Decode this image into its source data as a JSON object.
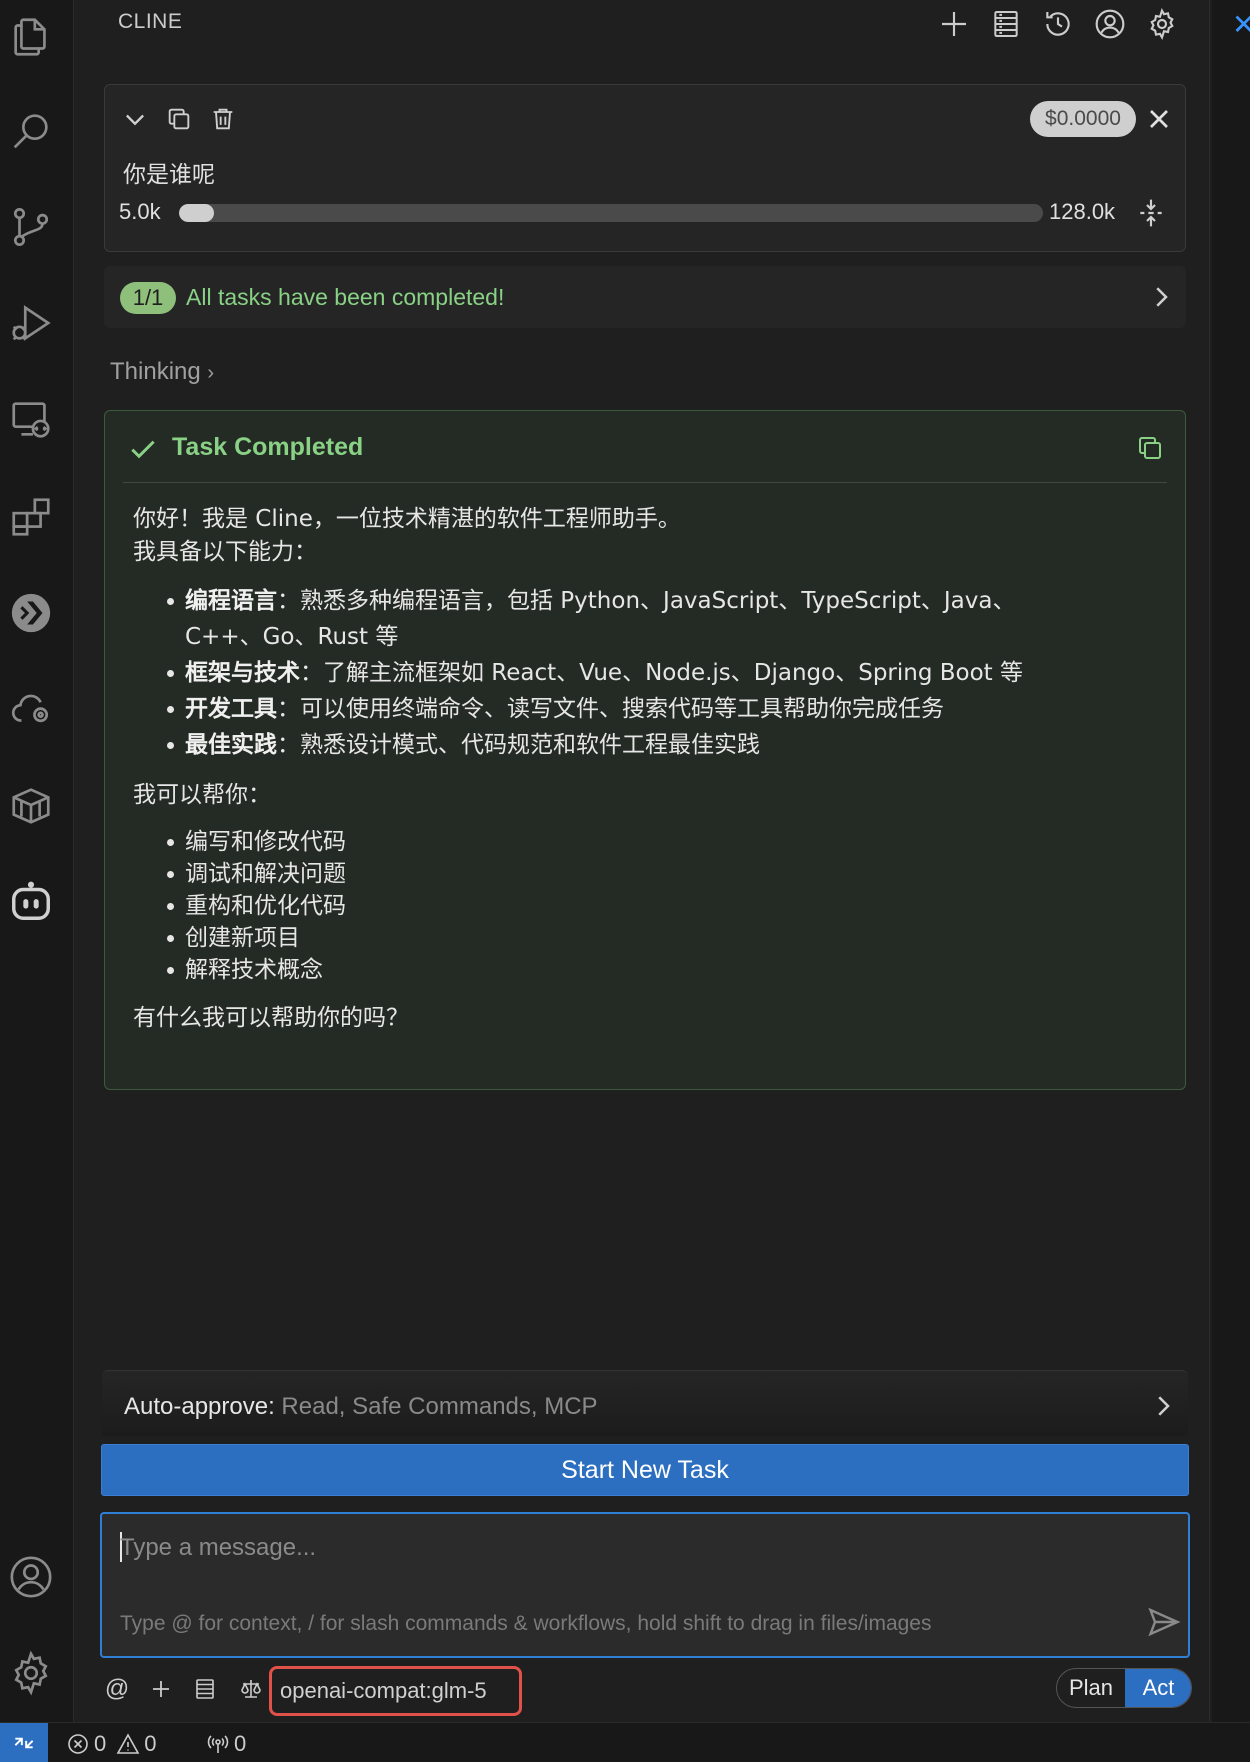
{
  "panel": {
    "title": "CLINE"
  },
  "task": {
    "text": "你是谁呢",
    "cost": "$0.0000",
    "tokens_used": "5.0k",
    "context_window": "128.0k",
    "context_used_fraction": 0.04
  },
  "tasks_progress": {
    "count": "1/1",
    "text": "All tasks have been completed!"
  },
  "thinking": {
    "label": "Thinking"
  },
  "completion": {
    "title": "Task Completed",
    "intro_line1": "你好！我是 Cline，一位技术精湛的软件工程师助手。",
    "intro_line2": "我具备以下能力：",
    "capabilities": [
      {
        "title": "编程语言",
        "text": "：熟悉多种编程语言，包括 Python、JavaScript、TypeScript、Java、",
        "text2": "C++、Go、Rust 等"
      },
      {
        "title": "框架与技术",
        "text": "：了解主流框架如 React、Vue、Node.js、Django、Spring Boot 等"
      },
      {
        "title": "开发工具",
        "text": "：可以使用终端命令、读写文件、搜索代码等工具帮助你完成任务"
      },
      {
        "title": "最佳实践",
        "text": "：熟悉设计模式、代码规范和软件工程最佳实践"
      }
    ],
    "help_heading": "我可以帮你：",
    "help_items": [
      "编写和修改代码",
      "调试和解决问题",
      "重构和优化代码",
      "创建新项目",
      "解释技术概念"
    ],
    "closing": "有什么我可以帮助你的吗？"
  },
  "auto_approve": {
    "label": "Auto-approve:",
    "values": " Read, Safe Commands, MCP"
  },
  "start_button": {
    "label": "Start New Task"
  },
  "chat_input": {
    "placeholder": "Type a message...",
    "hint": "Type @ for context, / for slash commands & workflows, hold shift to drag in files/images"
  },
  "toolbar": {
    "model": "openai-compat:glm-5",
    "mode_plan": "Plan",
    "mode_act": "Act",
    "active_mode": "Act"
  },
  "status_bar": {
    "errors": "0",
    "warnings": "0",
    "ports": "0"
  },
  "colors": {
    "accent_blue": "#2c6ec0",
    "success_green": "#89d185",
    "highlight_red": "#e0514a"
  }
}
